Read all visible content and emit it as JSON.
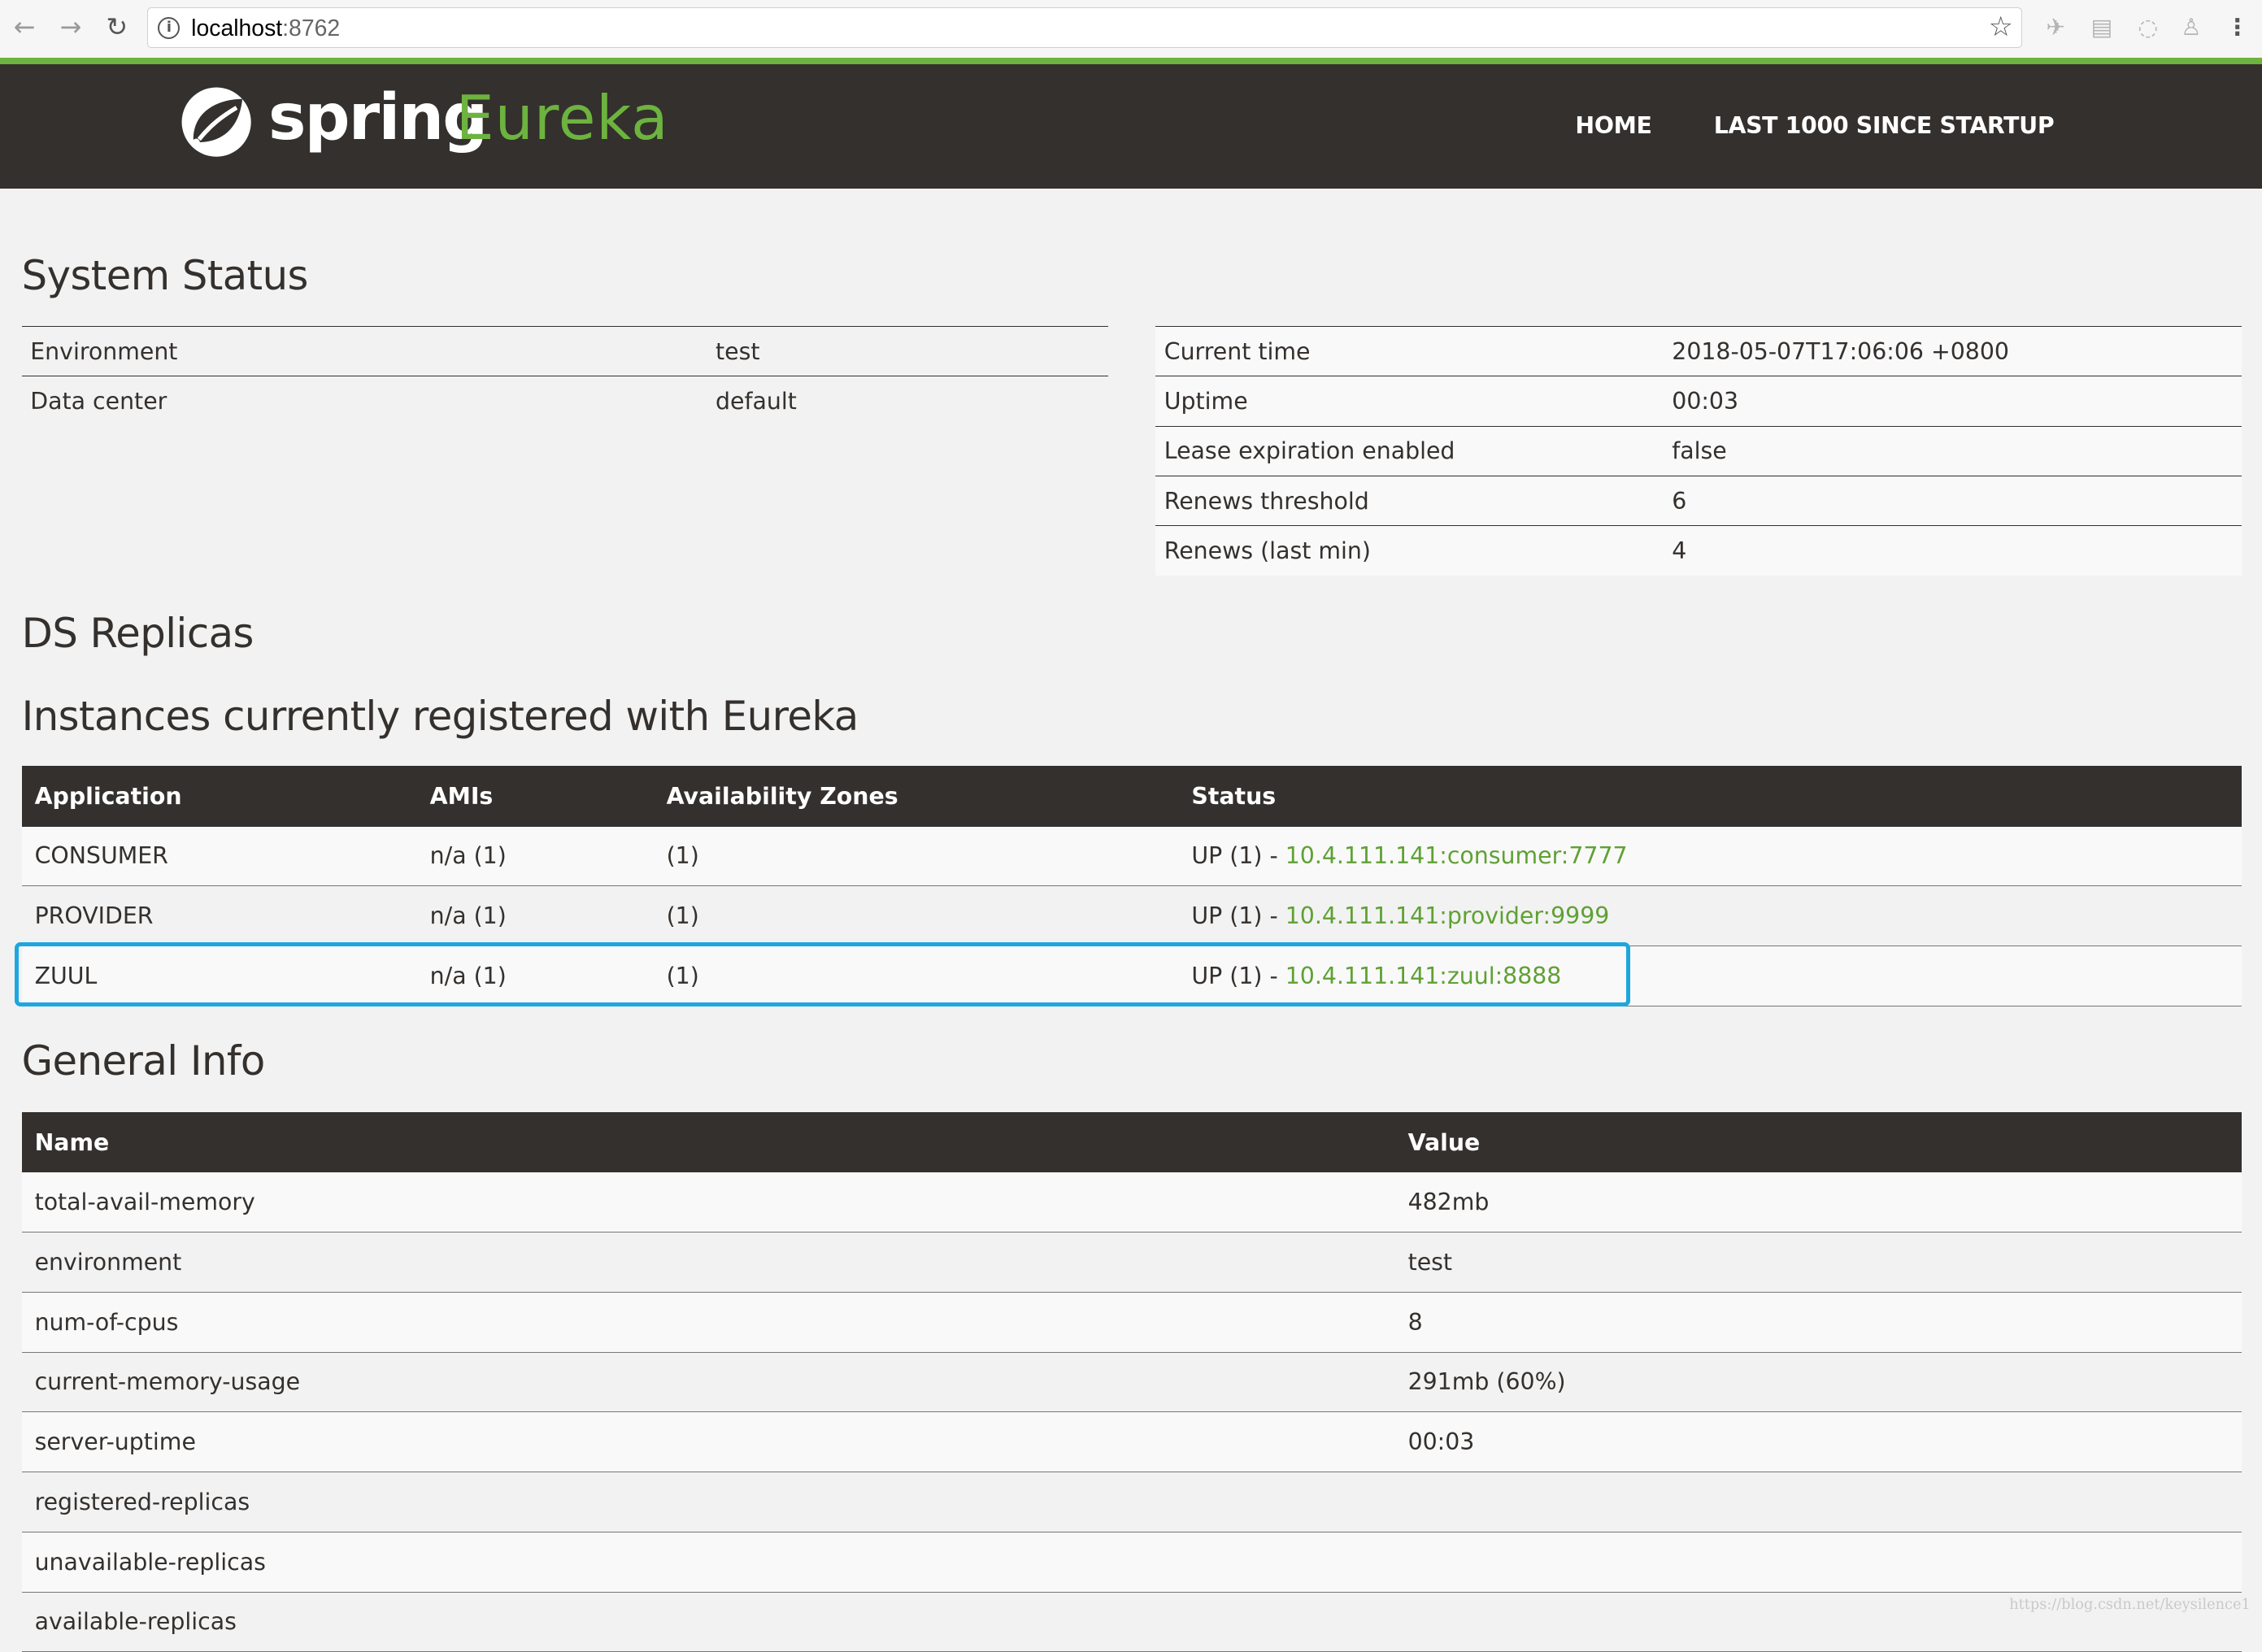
{
  "browser": {
    "url_host": "localhost",
    "url_port": ":8762"
  },
  "header": {
    "logo_spring": "spring",
    "logo_eureka": "Eureka",
    "nav": [
      "HOME",
      "LAST 1000 SINCE STARTUP"
    ]
  },
  "system_status": {
    "title": "System Status",
    "left": [
      {
        "key": "Environment",
        "value": "test"
      },
      {
        "key": "Data center",
        "value": "default"
      }
    ],
    "right": [
      {
        "key": "Current time",
        "value": "2018-05-07T17:06:06 +0800"
      },
      {
        "key": "Uptime",
        "value": "00:03"
      },
      {
        "key": "Lease expiration enabled",
        "value": "false"
      },
      {
        "key": "Renews threshold",
        "value": "6"
      },
      {
        "key": "Renews (last min)",
        "value": "4"
      }
    ]
  },
  "ds_replicas": {
    "title": "DS Replicas"
  },
  "instances": {
    "title": "Instances currently registered with Eureka",
    "columns": [
      "Application",
      "AMIs",
      "Availability Zones",
      "Status"
    ],
    "rows": [
      {
        "app": "CONSUMER",
        "amis": "n/a (1)",
        "zones": "(1)",
        "status": "UP (1) - ",
        "link": "10.4.111.141:consumer:7777"
      },
      {
        "app": "PROVIDER",
        "amis": "n/a (1)",
        "zones": "(1)",
        "status": "UP (1) - ",
        "link": "10.4.111.141:provider:9999"
      },
      {
        "app": "ZUUL",
        "amis": "n/a (1)",
        "zones": "(1)",
        "status": "UP (1) - ",
        "link": "10.4.111.141:zuul:8888"
      }
    ]
  },
  "general_info": {
    "title": "General Info",
    "columns": [
      "Name",
      "Value"
    ],
    "rows": [
      {
        "name": "total-avail-memory",
        "value": "482mb"
      },
      {
        "name": "environment",
        "value": "test"
      },
      {
        "name": "num-of-cpus",
        "value": "8"
      },
      {
        "name": "current-memory-usage",
        "value": "291mb (60%)"
      },
      {
        "name": "server-uptime",
        "value": "00:03"
      },
      {
        "name": "registered-replicas",
        "value": ""
      },
      {
        "name": "unavailable-replicas",
        "value": ""
      },
      {
        "name": "available-replicas",
        "value": ""
      }
    ]
  },
  "watermark": "https://blog.csdn.net/keysilence1",
  "colors": {
    "brand_green": "#6db33f",
    "header_bg": "#34302d",
    "highlight": "#1ea6df"
  }
}
